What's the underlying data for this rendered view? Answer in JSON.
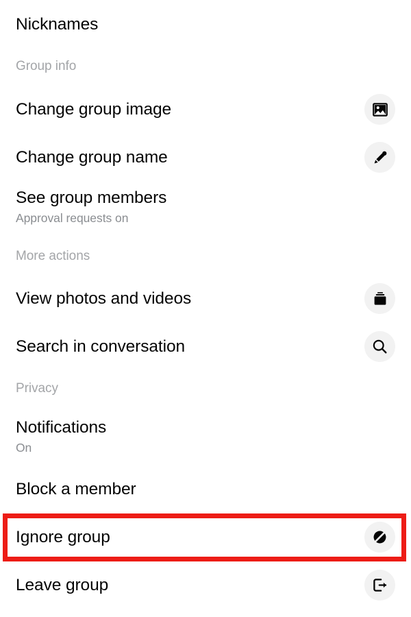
{
  "screen": {
    "name": "Group settings menu",
    "background": "#ffffff",
    "text_color": "#050505",
    "muted_color": "#8a8d91",
    "section_color": "#a3a5a8",
    "icon_bubble_color": "#f2f2f2",
    "highlight_color": "#ed1c16"
  },
  "rows": [
    {
      "key": "nicknames",
      "label": "Nicknames",
      "subtitle": "",
      "icon": ""
    },
    {
      "key": "change-group-image",
      "label": "Change group image",
      "subtitle": "",
      "icon": "image-icon"
    },
    {
      "key": "change-group-name",
      "label": "Change group name",
      "subtitle": "",
      "icon": "pencil-icon"
    },
    {
      "key": "see-group-members",
      "label": "See group members",
      "subtitle": "Approval requests on",
      "icon": ""
    },
    {
      "key": "view-photos-and-videos",
      "label": "View photos and videos",
      "subtitle": "",
      "icon": "photo-stack-icon"
    },
    {
      "key": "search-in-conversation",
      "label": "Search in conversation",
      "subtitle": "",
      "icon": "search-icon"
    },
    {
      "key": "notifications",
      "label": "Notifications",
      "subtitle": "On",
      "icon": ""
    },
    {
      "key": "block-a-member",
      "label": "Block a member",
      "subtitle": "",
      "icon": ""
    },
    {
      "key": "ignore-group",
      "label": "Ignore group",
      "subtitle": "",
      "icon": "ignore-slash-icon"
    },
    {
      "key": "leave-group",
      "label": "Leave group",
      "subtitle": "",
      "icon": "exit-icon"
    }
  ],
  "sections": [
    {
      "key": "group-info",
      "label": "Group info"
    },
    {
      "key": "more-actions",
      "label": "More actions"
    },
    {
      "key": "privacy",
      "label": "Privacy"
    }
  ],
  "annotation": {
    "type": "red-rectangle-highlight",
    "targets": "ignore-group"
  }
}
